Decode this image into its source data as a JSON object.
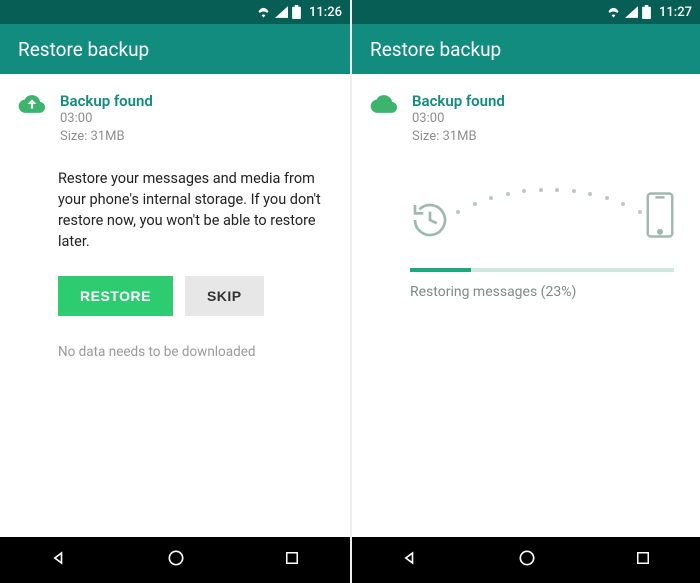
{
  "left": {
    "status": {
      "time": "11:26"
    },
    "appbar": {
      "title": "Restore backup"
    },
    "backup": {
      "title": "Backup found",
      "time": "03:00",
      "size": "Size: 31MB",
      "cloud_upload": true
    },
    "body": "Restore your messages and media from your phone's internal storage. If you don't restore now, you won't be able to restore later.",
    "buttons": {
      "restore": "RESTORE",
      "skip": "SKIP"
    },
    "footer": "No data needs to be downloaded"
  },
  "right": {
    "status": {
      "time": "11:27"
    },
    "appbar": {
      "title": "Restore backup"
    },
    "backup": {
      "title": "Backup found",
      "time": "03:00",
      "size": "Size: 31MB",
      "cloud_upload": false
    },
    "progress": {
      "percent": 23,
      "label": "Restoring messages (23%)"
    }
  },
  "colors": {
    "statusbar": "#075E54",
    "appbar": "#128C7E",
    "primaryBtn": "#2ecc71",
    "progress": "#1ea97c"
  }
}
